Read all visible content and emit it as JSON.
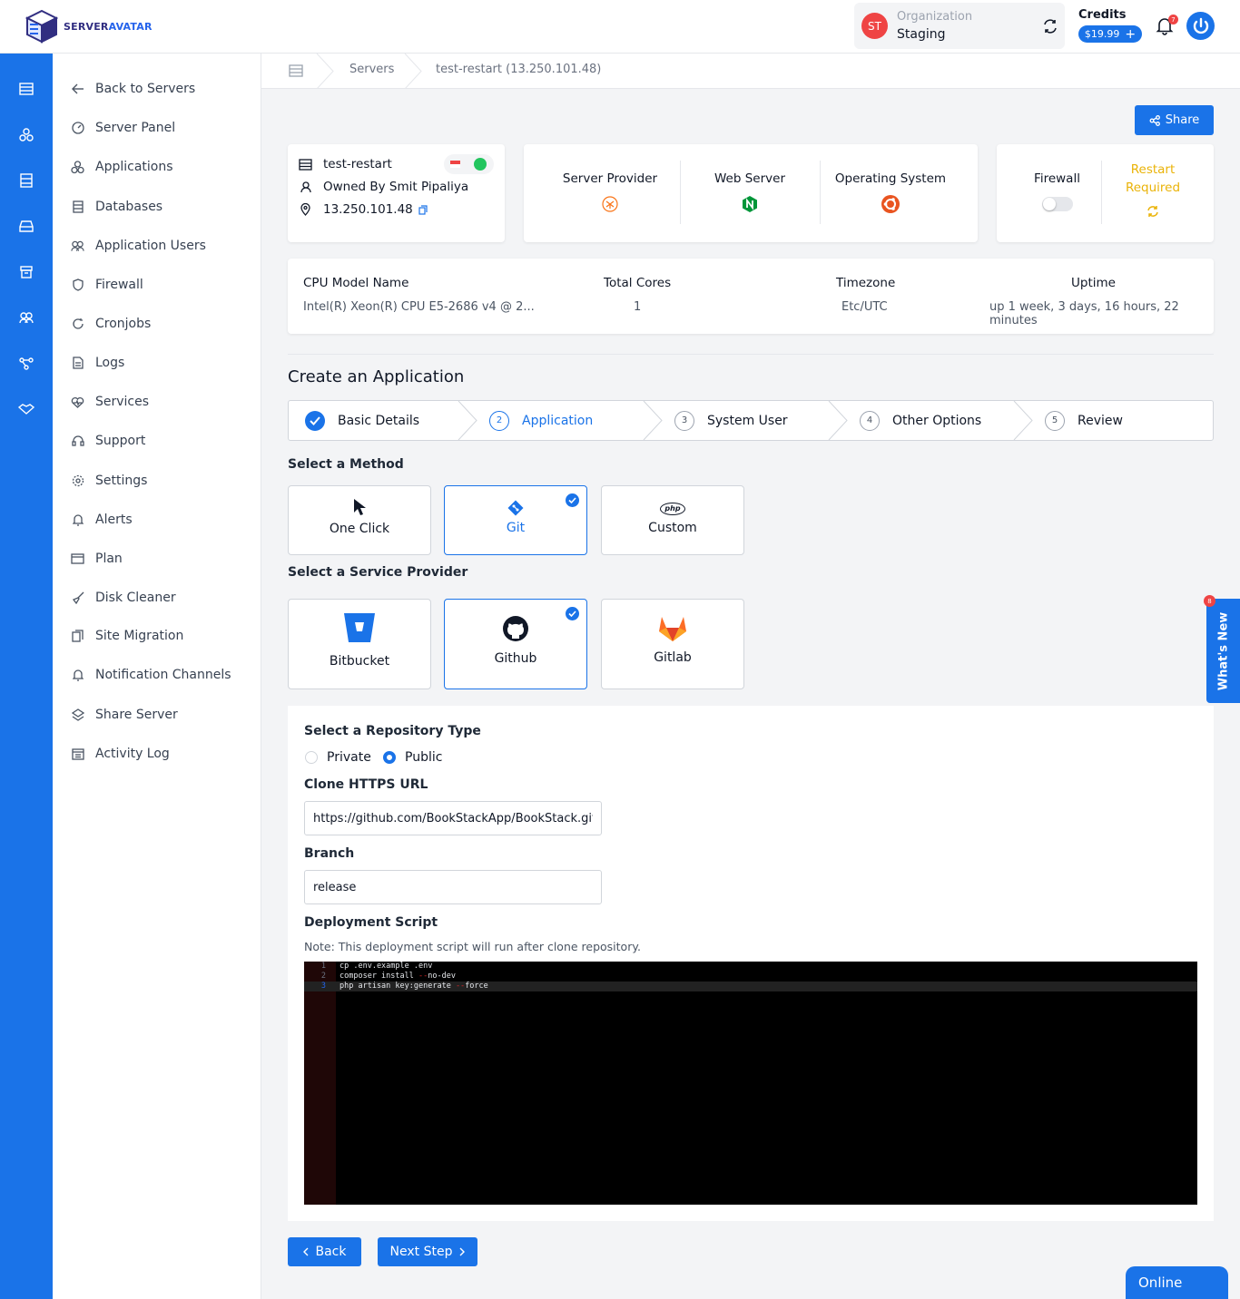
{
  "brand": {
    "part1": "SERVER",
    "part2": "AVATAR"
  },
  "org": {
    "initials": "ST",
    "label": "Organization",
    "name": "Staging"
  },
  "credits": {
    "label": "Credits",
    "amount": "$19.99",
    "plus": "+"
  },
  "notifications": {
    "count": "7"
  },
  "sidebar": {
    "items": [
      {
        "label": "Back to Servers",
        "icon": "arrow-left-icon"
      },
      {
        "label": "Server Panel",
        "icon": "gauge-icon"
      },
      {
        "label": "Applications",
        "icon": "cubes-icon"
      },
      {
        "label": "Databases",
        "icon": "database-icon"
      },
      {
        "label": "Application Users",
        "icon": "users-icon"
      },
      {
        "label": "Firewall",
        "icon": "shield-icon"
      },
      {
        "label": "Cronjobs",
        "icon": "refresh-icon"
      },
      {
        "label": "Logs",
        "icon": "file-icon"
      },
      {
        "label": "Services",
        "icon": "heart-pulse-icon"
      },
      {
        "label": "Support",
        "icon": "headset-icon"
      },
      {
        "label": "Settings",
        "icon": "gear-icon"
      },
      {
        "label": "Alerts",
        "icon": "bell-icon"
      },
      {
        "label": "Plan",
        "icon": "card-icon"
      },
      {
        "label": "Disk Cleaner",
        "icon": "broom-icon"
      },
      {
        "label": "Site Migration",
        "icon": "copy-icon"
      },
      {
        "label": "Notification Channels",
        "icon": "bell-icon"
      },
      {
        "label": "Share Server",
        "icon": "share-icon"
      },
      {
        "label": "Activity Log",
        "icon": "calendar-icon"
      }
    ]
  },
  "breadcrumb": {
    "servers": "Servers",
    "current": "test-restart (13.250.101.48)"
  },
  "share_label": "Share",
  "server": {
    "name": "test-restart",
    "owner": "Owned By Smit Pipaliya",
    "ip": "13.250.101.48"
  },
  "info": {
    "provider": "Server Provider",
    "web_server": "Web Server",
    "os": "Operating System",
    "firewall": "Firewall",
    "restart": "Restart Required"
  },
  "stats": {
    "cpu_label": "CPU Model Name",
    "cpu_value": "Intel(R) Xeon(R) CPU E5-2686 v4 @ 2...",
    "cores_label": "Total Cores",
    "cores_value": "1",
    "tz_label": "Timezone",
    "tz_value": "Etc/UTC",
    "uptime_label": "Uptime",
    "uptime_value": "up 1 week, 3 days, 16 hours, 22 minutes"
  },
  "create_title": "Create an Application",
  "steps": [
    {
      "num": "1",
      "label": "Basic Details"
    },
    {
      "num": "2",
      "label": "Application"
    },
    {
      "num": "3",
      "label": "System User"
    },
    {
      "num": "4",
      "label": "Other Options"
    },
    {
      "num": "5",
      "label": "Review"
    }
  ],
  "method": {
    "label": "Select a Method",
    "one_click": "One Click",
    "git": "Git",
    "custom": "Custom",
    "php_badge": "php"
  },
  "provider": {
    "label": "Select a Service Provider",
    "bitbucket": "Bitbucket",
    "github": "Github",
    "gitlab": "Gitlab"
  },
  "repo": {
    "type_label": "Select a Repository Type",
    "private": "Private",
    "public": "Public",
    "url_label": "Clone HTTPS URL",
    "url_value": "https://github.com/BookStackApp/BookStack.git",
    "branch_label": "Branch",
    "branch_value": "release",
    "script_label": "Deployment Script",
    "note": "Note: This deployment script will run after clone repository.",
    "script_lines": [
      {
        "n": "1",
        "a": "cp .env.example .env",
        "dash": "",
        "b": ""
      },
      {
        "n": "2",
        "a": "composer install ",
        "dash": "--",
        "b": "no-dev"
      },
      {
        "n": "3",
        "a": "php artisan key:generate ",
        "dash": "--",
        "b": "force"
      }
    ]
  },
  "back_label": "Back",
  "next_label": "Next Step",
  "whats_new": {
    "label": "What's New",
    "count": "8"
  },
  "online_label": "Online",
  "colors": {
    "primary": "#1a73e8",
    "success": "#22c55e",
    "warning": "#eab308",
    "danger": "#ef4444"
  }
}
